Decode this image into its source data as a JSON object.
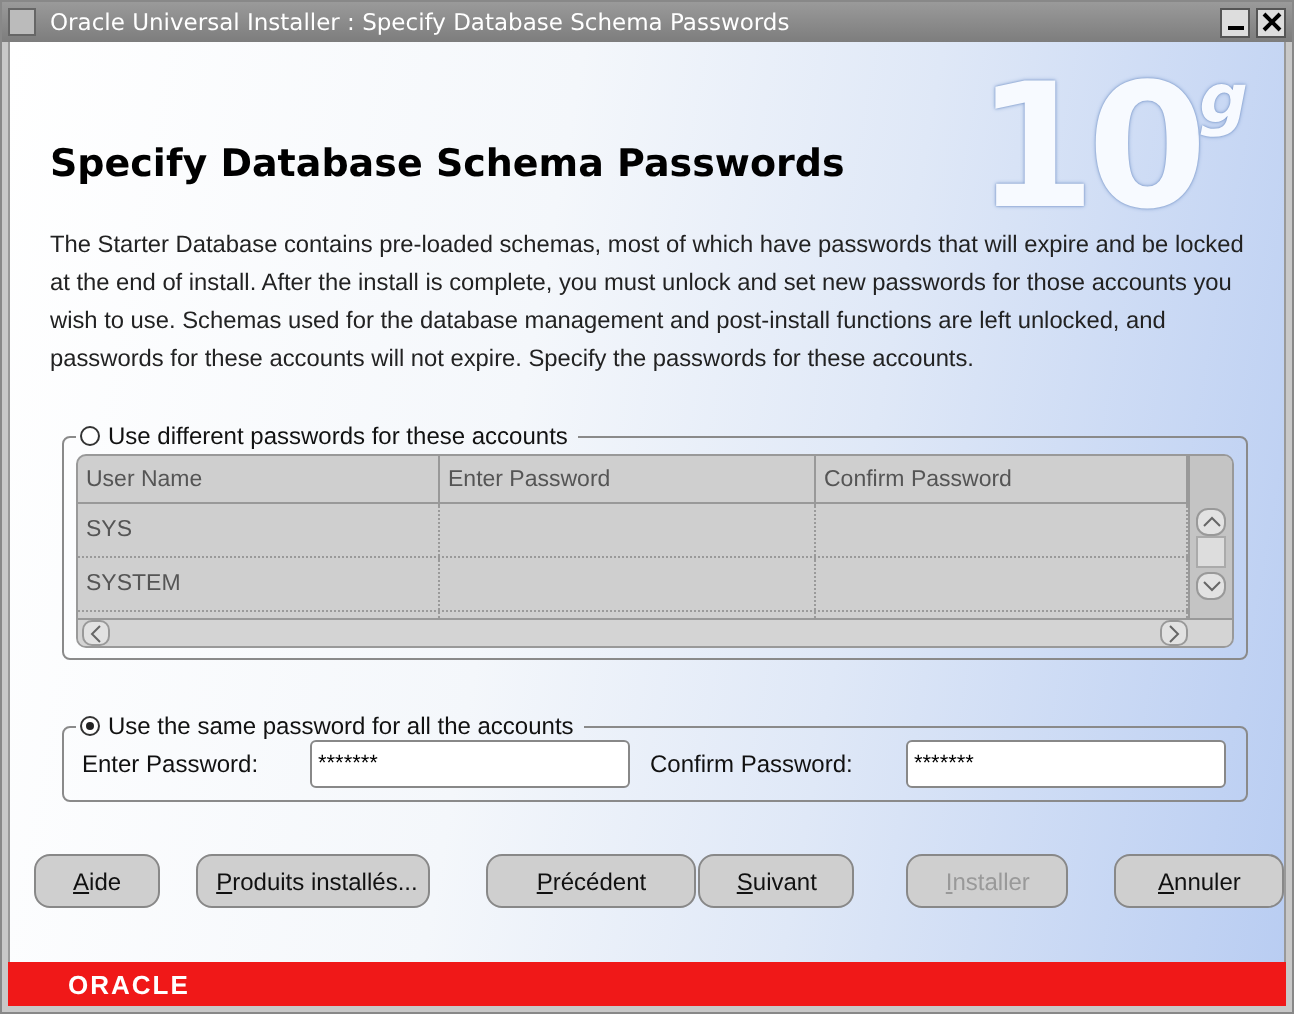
{
  "window": {
    "title": "Oracle Universal Installer : Specify Database Schema Passwords"
  },
  "logo": {
    "number": "10",
    "letter": "g"
  },
  "heading": "Specify Database Schema Passwords",
  "description": "The Starter Database contains pre-loaded schemas, most of which have passwords that will expire and be locked at the end of install. After the install is complete, you must unlock and set new passwords for those accounts you wish to use. Schemas used for the database management and post-install functions are left unlocked, and passwords for these accounts will not expire. Specify the passwords for these accounts.",
  "options": [
    {
      "label": "Use different passwords for these accounts",
      "selected": false
    },
    {
      "label": "Use the same password for all the accounts",
      "selected": true
    }
  ],
  "table": {
    "columns": [
      "User Name",
      "Enter Password",
      "Confirm Password"
    ],
    "rows": [
      [
        "SYS",
        "",
        ""
      ],
      [
        "SYSTEM",
        "",
        ""
      ]
    ]
  },
  "same_password": {
    "fields": [
      {
        "label": "Enter Password:",
        "value": "*******"
      },
      {
        "label": "Confirm Password:",
        "value": "*******"
      }
    ]
  },
  "buttons": [
    {
      "label": "Aide",
      "disabled": false
    },
    {
      "label": "Produits installés...",
      "disabled": false
    },
    {
      "label": "Précédent",
      "disabled": false
    },
    {
      "label": "Suivant",
      "disabled": false
    },
    {
      "label": "Installer",
      "disabled": true
    },
    {
      "label": "Annuler",
      "disabled": false
    }
  ],
  "footer": {
    "brand": "ORACLE"
  }
}
